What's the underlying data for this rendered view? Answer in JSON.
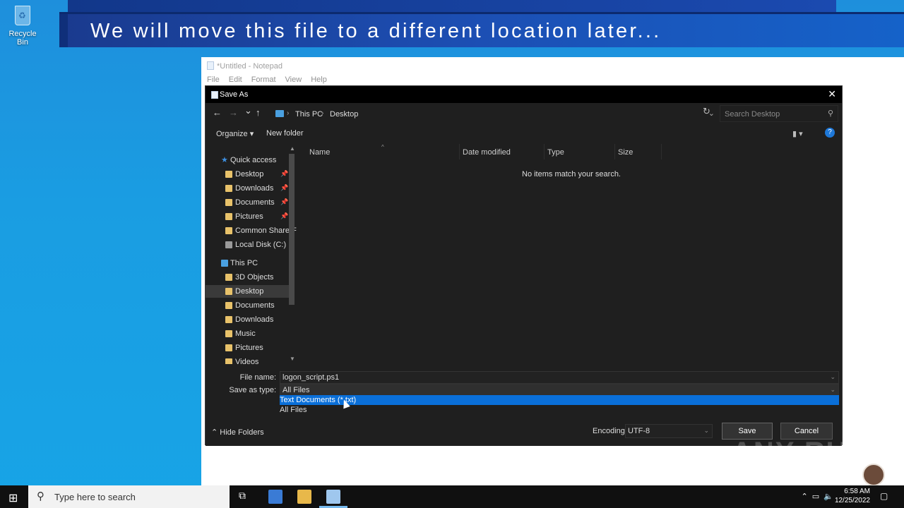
{
  "desktop": {
    "recycle_bin_label": "Recycle Bin"
  },
  "banner": {
    "text": "We will move this file to a different location later..."
  },
  "notepad": {
    "title": "*Untitled - Notepad",
    "menu": [
      "File",
      "Edit",
      "Format",
      "View",
      "Help"
    ]
  },
  "dialog": {
    "title": "Save As",
    "close_glyph": "✕",
    "nav": {
      "back": "←",
      "forward": "→",
      "dropdown": "⌄",
      "up": "↑"
    },
    "breadcrumb": [
      "This PC",
      "Desktop"
    ],
    "refresh_glyph": "↻",
    "search_placeholder": "Search Desktop",
    "toolbar": {
      "organize": "Organize ▾",
      "new_folder": "New folder"
    },
    "nav_pane": {
      "items": [
        {
          "label": "Quick access",
          "icon": "star-icon",
          "indent": 1
        },
        {
          "label": "Desktop",
          "icon": "folder-icon",
          "indent": 2,
          "pinned": true
        },
        {
          "label": "Downloads",
          "icon": "folder-icon",
          "indent": 2,
          "pinned": true
        },
        {
          "label": "Documents",
          "icon": "folder-icon",
          "indent": 2,
          "pinned": true
        },
        {
          "label": "Pictures",
          "icon": "folder-icon",
          "indent": 2,
          "pinned": true
        },
        {
          "label": "Common Share F",
          "icon": "folder-icon",
          "indent": 2
        },
        {
          "label": "Local Disk (C:)",
          "icon": "disk-icon",
          "indent": 2
        },
        {
          "label": "This PC",
          "icon": "pc-icon",
          "indent": 1
        },
        {
          "label": "3D Objects",
          "icon": "folder-icon",
          "indent": 2
        },
        {
          "label": "Desktop",
          "icon": "folder-icon",
          "indent": 2,
          "selected": true
        },
        {
          "label": "Documents",
          "icon": "folder-icon",
          "indent": 2
        },
        {
          "label": "Downloads",
          "icon": "folder-icon",
          "indent": 2
        },
        {
          "label": "Music",
          "icon": "folder-icon",
          "indent": 2
        },
        {
          "label": "Pictures",
          "icon": "folder-icon",
          "indent": 2
        },
        {
          "label": "Videos",
          "icon": "folder-icon",
          "indent": 2
        }
      ]
    },
    "columns": [
      "Name",
      "Date modified",
      "Type",
      "Size"
    ],
    "empty_message": "No items match your search.",
    "file_name_label": "File name:",
    "file_name_value": "logon_script.ps1",
    "save_as_type_label": "Save as type:",
    "save_as_type_value": "All Files",
    "type_options": [
      "Text Documents (*.txt)",
      "All Files"
    ],
    "hide_folders": "Hide Folders",
    "encoding_label": "Encoding:",
    "encoding_value": "UTF-8",
    "save_button": "Save",
    "cancel_button": "Cancel"
  },
  "watermark": "ANY RUN",
  "taskbar": {
    "search_placeholder": "Type here to search",
    "time": "6:58 AM",
    "date": "12/25/2022"
  },
  "colors": {
    "accent": "#0a6fd8",
    "dialog_bg": "#1f1f1f",
    "desktop": "#1a9de2"
  }
}
